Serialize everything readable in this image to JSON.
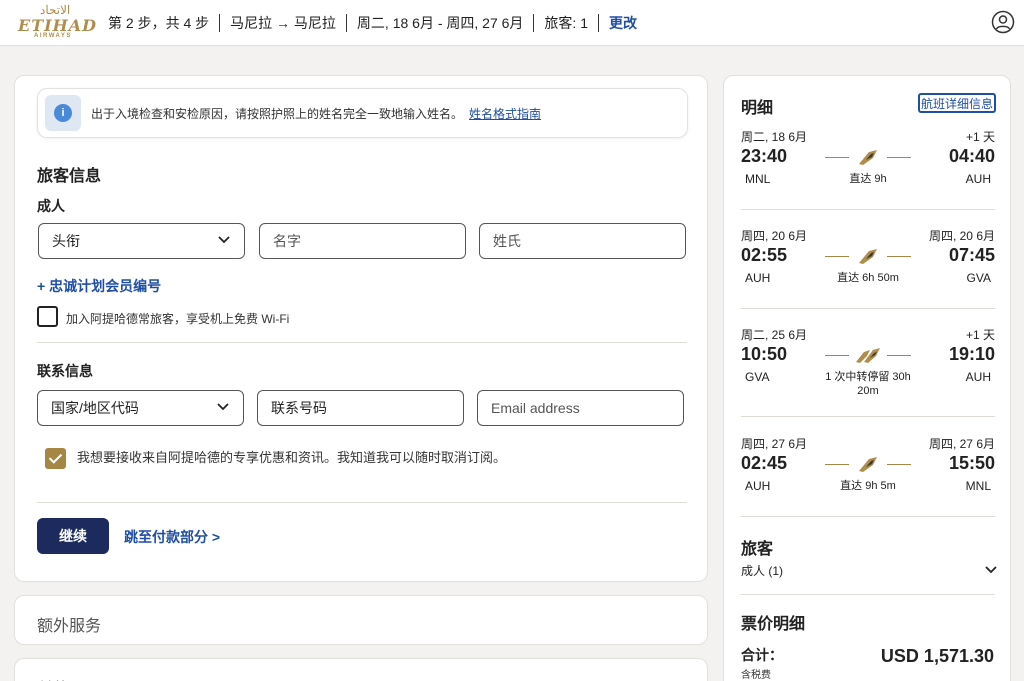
{
  "header": {
    "logo_arabic": "الاتحاد",
    "logo_text": "ETIHAD",
    "logo_sub": "AIRWAYS",
    "step": "第 2 步，共 4 步",
    "route": "马尼拉 → 马尼拉",
    "dates": "周二, 18 6月 - 周四, 27 6月",
    "travelers": "旅客: 1",
    "change": "更改"
  },
  "notice": {
    "text": "出于入境检查和安检原因，请按照护照上的姓名完全一致地输入姓名。",
    "link": "姓名格式指南"
  },
  "traveler_info": {
    "title": "旅客信息",
    "adult_label": "成人",
    "title_select": "头衔",
    "first_name_placeholder": "名字",
    "last_name_placeholder": "姓氏",
    "loyalty_link": "+ 忠诚计划会员编号",
    "guest_checkbox_label": "加入阿提哈德常旅客，享受机上免费 Wi-Fi"
  },
  "contact_info": {
    "title": "联系信息",
    "country_code": "国家/地区代码",
    "phone": "联系号码",
    "email_placeholder": "Email address",
    "marketing_label": "我想要接收来自阿提哈德的专享优惠和资讯。我知道我可以随时取消订阅。"
  },
  "actions": {
    "continue": "继续",
    "jump_to_payment": "跳至付款部分 >"
  },
  "sections": {
    "extras": "额外服务",
    "payment": "付款"
  },
  "sidebar": {
    "title": "明细",
    "detail_button": "航班详细信息",
    "flights": [
      {
        "dep_date": "周二, 18 6月",
        "arr_date": "+1 天",
        "dep_time": "23:40",
        "arr_time": "04:40",
        "dep_code": "MNL",
        "arr_code": "AUH",
        "duration": "直达 9h"
      },
      {
        "dep_date": "周四, 20 6月",
        "arr_date": "周四, 20 6月",
        "dep_time": "02:55",
        "arr_time": "07:45",
        "dep_code": "AUH",
        "arr_code": "GVA",
        "duration": "直达 6h 50m"
      },
      {
        "dep_date": "周二, 25 6月",
        "arr_date": "+1 天",
        "dep_time": "10:50",
        "arr_time": "19:10",
        "dep_code": "GVA",
        "arr_code": "AUH",
        "duration": "1 次中转停留 30h 20m"
      },
      {
        "dep_date": "周四, 27 6月",
        "arr_date": "周四, 27 6月",
        "dep_time": "02:45",
        "arr_time": "15:50",
        "dep_code": "AUH",
        "arr_code": "MNL",
        "duration": "直达 9h 5m"
      }
    ],
    "travelers_title": "旅客",
    "travelers_value": "成人 (1)",
    "fare_title": "票价明细",
    "total_label": "合计：",
    "tax_label": "含税费",
    "total_value": "USD 1,571.30"
  },
  "colors": {
    "brand_gold": "#a68644",
    "primary_navy": "#1c2a5e",
    "link_blue": "#1f4ea3"
  }
}
